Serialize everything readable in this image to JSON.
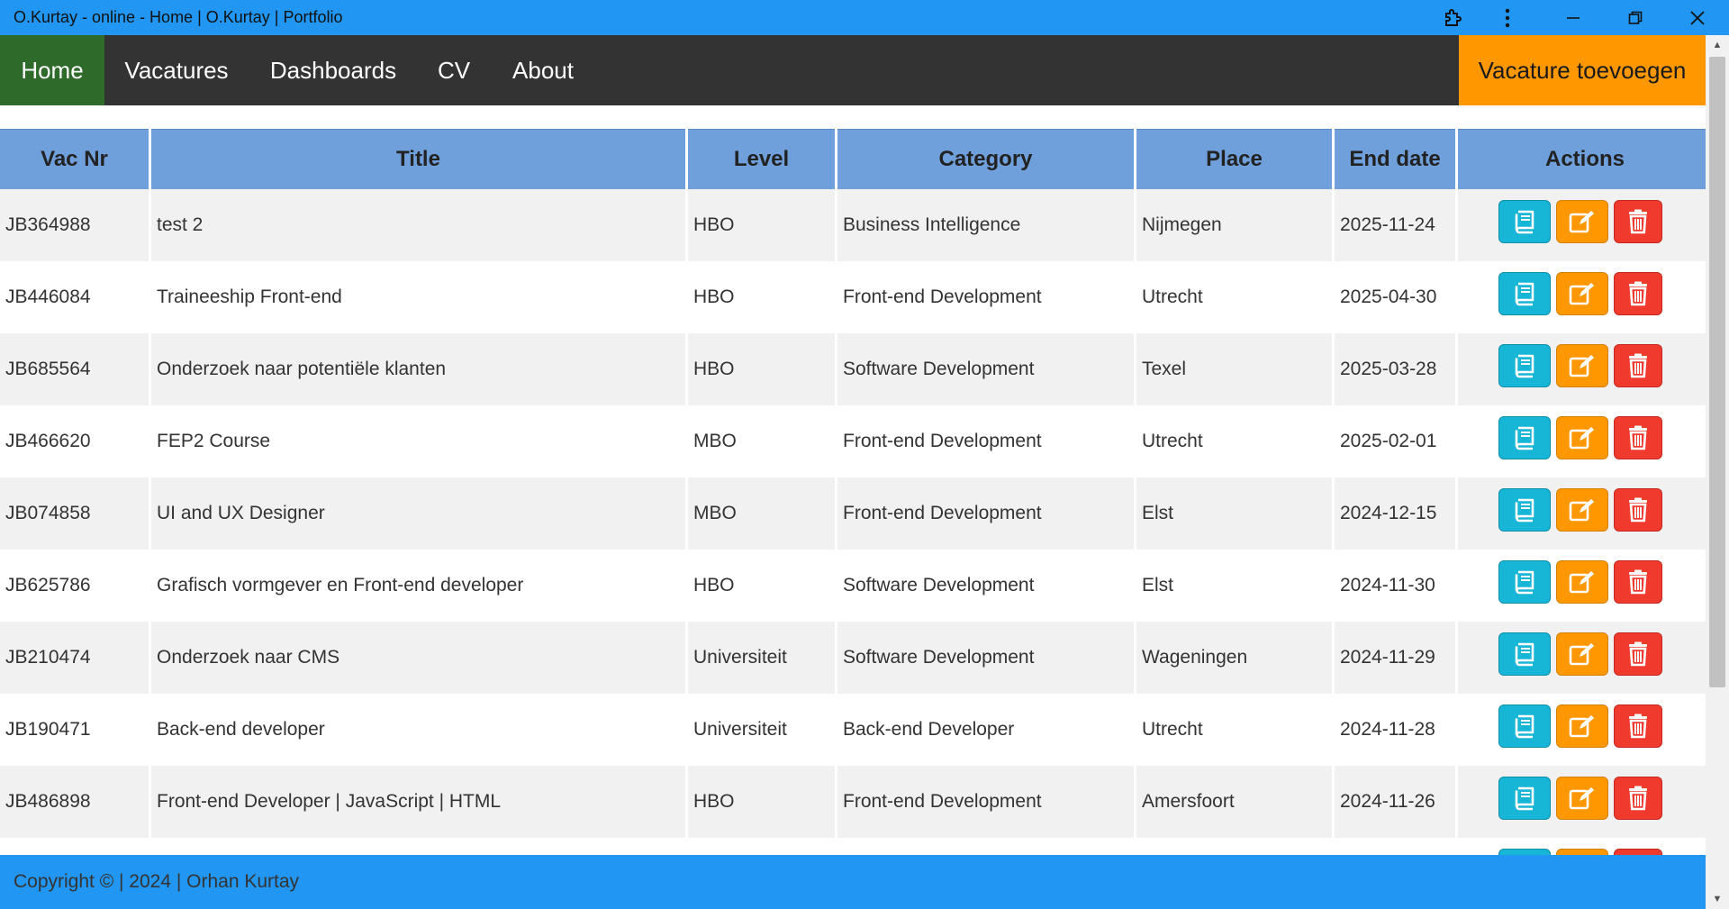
{
  "window": {
    "title": "O.Kurtay - online - Home | O.Kurtay | Portfolio"
  },
  "nav": {
    "items": [
      {
        "label": "Home",
        "active": true
      },
      {
        "label": "Vacatures",
        "active": false
      },
      {
        "label": "Dashboards",
        "active": false
      },
      {
        "label": "CV",
        "active": false
      },
      {
        "label": "About",
        "active": false
      }
    ],
    "cta_label": "Vacature toevoegen"
  },
  "table": {
    "headers": [
      "Vac Nr",
      "Title",
      "Level",
      "Category",
      "Place",
      "End date",
      "Actions"
    ],
    "rows": [
      [
        "JB364988",
        "test 2",
        "HBO",
        "Business Intelligence",
        "Nijmegen",
        "2025-11-24"
      ],
      [
        "JB446084",
        "Traineeship Front-end",
        "HBO",
        "Front-end Development",
        "Utrecht",
        "2025-04-30"
      ],
      [
        "JB685564",
        "Onderzoek naar potentiële klanten",
        "HBO",
        "Software Development",
        "Texel",
        "2025-03-28"
      ],
      [
        "JB466620",
        "FEP2 Course",
        "MBO",
        "Front-end Development",
        "Utrecht",
        "2025-02-01"
      ],
      [
        "JB074858",
        "UI and UX Designer",
        "MBO",
        "Front-end Development",
        "Elst",
        "2024-12-15"
      ],
      [
        "JB625786",
        "Grafisch vormgever en Front-end developer",
        "HBO",
        "Software Development",
        "Elst",
        "2024-11-30"
      ],
      [
        "JB210474",
        "Onderzoek naar CMS",
        "Universiteit",
        "Software Development",
        "Wageningen",
        "2024-11-29"
      ],
      [
        "JB190471",
        "Back-end developer",
        "Universiteit",
        "Back-end Developer",
        "Utrecht",
        "2024-11-28"
      ],
      [
        "JB486898",
        "Front-end Developer | JavaScript | HTML",
        "HBO",
        "Front-end Development",
        "Amersfoort",
        "2024-11-26"
      ],
      [
        "",
        "",
        "",
        "",
        "",
        ""
      ]
    ],
    "action_icons": [
      "book-icon",
      "edit-icon",
      "trash-icon"
    ]
  },
  "footer": {
    "text": "Copyright © | 2024 | Orhan Kurtay"
  },
  "colors": {
    "titlebar": "#2196f3",
    "navbar": "#333333",
    "nav_active": "#2e6b2a",
    "cta": "#ff9800",
    "header": "#6fa0dc",
    "view_button": "#17b5d6",
    "edit_button": "#ff9800",
    "delete_button": "#f13a2e"
  }
}
